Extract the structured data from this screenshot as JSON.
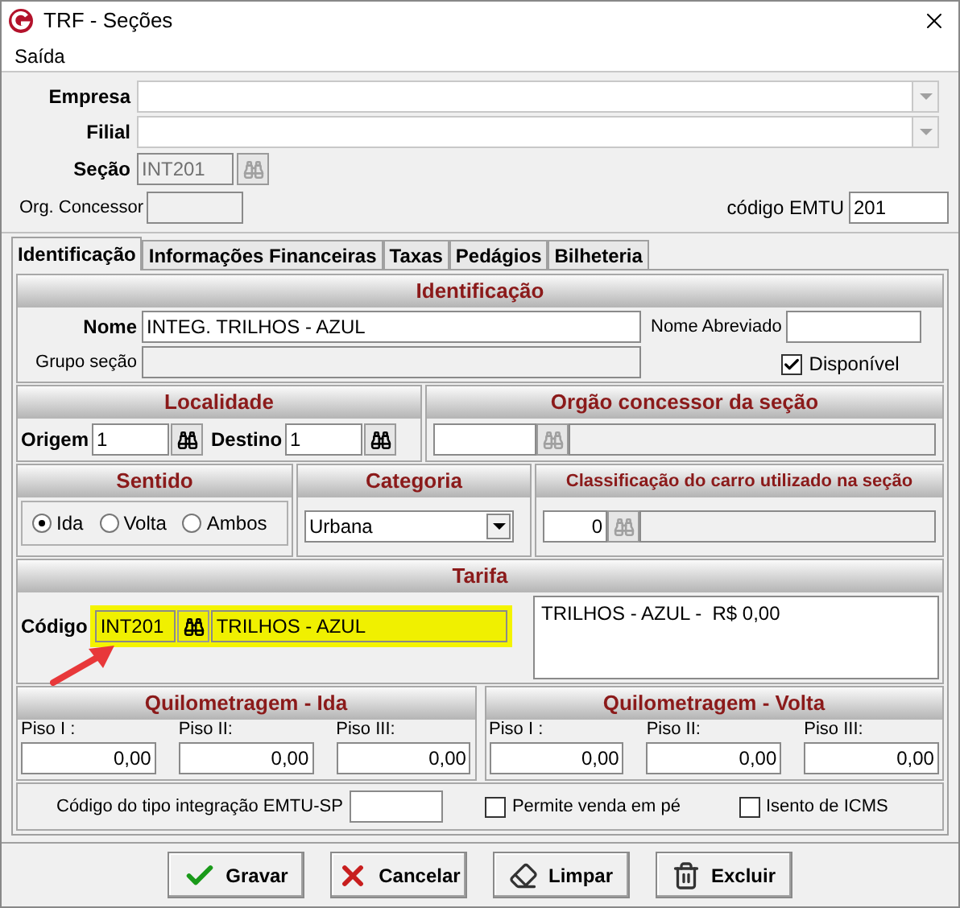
{
  "window": {
    "title": "TRF - Seções"
  },
  "menu": [
    {
      "label": "Saída"
    }
  ],
  "header": {
    "empresa": {
      "label": "Empresa"
    },
    "filial": {
      "label": "Filial"
    },
    "secao": {
      "label": "Seção",
      "value": "INT201"
    },
    "org_concessor": {
      "label": "Org. Concessor"
    },
    "codigo_emtu": {
      "label": "código EMTU",
      "value": "201"
    }
  },
  "tabs": [
    {
      "label": "Identificação",
      "selected": true
    },
    {
      "label": "Informações Financeiras",
      "selected": false
    },
    {
      "label": "Taxas",
      "selected": false
    },
    {
      "label": "Pedágios",
      "selected": false
    },
    {
      "label": "Bilheteria",
      "selected": false
    }
  ],
  "identificacao": {
    "title": "Identificação",
    "nome": {
      "label": "Nome",
      "value": "INTEG. TRILHOS - AZUL"
    },
    "nome_abreviado": {
      "label": "Nome Abreviado"
    },
    "grupo_secao": {
      "label": "Grupo seção"
    },
    "disponivel": {
      "label": "Disponível",
      "checked": true
    }
  },
  "localidade": {
    "title": "Localidade",
    "origem": {
      "label": "Origem",
      "value": "1"
    },
    "destino": {
      "label": "Destino",
      "value": "1"
    }
  },
  "orgao_concessor": {
    "title": "Orgão concessor da seção"
  },
  "sentido": {
    "title": "Sentido",
    "options": [
      {
        "label": "Ida",
        "selected": true
      },
      {
        "label": "Volta",
        "selected": false
      },
      {
        "label": "Ambos",
        "selected": false
      }
    ]
  },
  "categoria": {
    "title": "Categoria",
    "value": "Urbana"
  },
  "classificacao": {
    "title": "Classificação do carro utilizado na seção",
    "value": "0"
  },
  "tarifa": {
    "title": "Tarifa",
    "codigo": {
      "label": "Código",
      "value": "INT201"
    },
    "descricao": "TRILHOS - AZUL",
    "detail": "TRILHOS - AZUL -  R$ 0,00"
  },
  "quilometragem": [
    {
      "title": "Quilometragem - Ida",
      "pisos": [
        {
          "label": "Piso I :",
          "value": "0,00"
        },
        {
          "label": "Piso II:",
          "value": "0,00"
        },
        {
          "label": "Piso III:",
          "value": "0,00"
        }
      ]
    },
    {
      "title": "Quilometragem - Volta",
      "pisos": [
        {
          "label": "Piso I :",
          "value": "0,00"
        },
        {
          "label": "Piso II:",
          "value": "0,00"
        },
        {
          "label": "Piso III:",
          "value": "0,00"
        }
      ]
    }
  ],
  "footer": {
    "codigo_integracao": {
      "label": "Código do tipo integração EMTU-SP"
    },
    "permite_venda": {
      "label": "Permite venda em pé",
      "checked": false
    },
    "isento_icms": {
      "label": "Isento de ICMS",
      "checked": false
    }
  },
  "buttons": [
    {
      "label": "Gravar",
      "kind": "save"
    },
    {
      "label": "Cancelar",
      "kind": "cancel"
    },
    {
      "label": "Limpar",
      "kind": "clear"
    },
    {
      "label": "Excluir",
      "kind": "delete"
    }
  ]
}
